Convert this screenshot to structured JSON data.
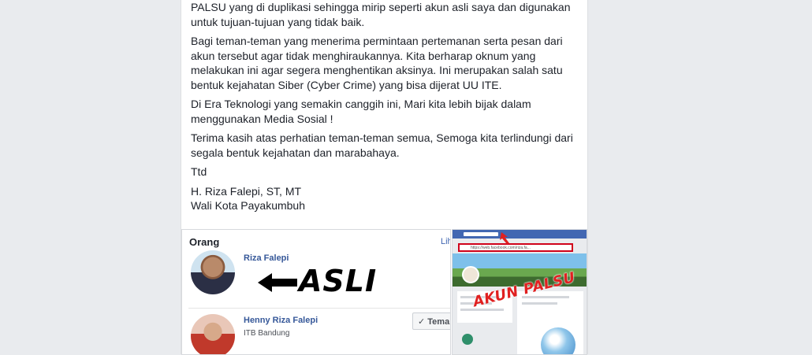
{
  "post": {
    "paragraphs": [
      "PALSU yang di duplikasi sehingga mirip seperti akun asli saya dan digunakan untuk tujuan-tujuan yang tidak baik.",
      "Bagi teman-teman yang menerima permintaan pertemanan serta pesan dari akun tersebut agar tidak menghiraukannya. Kita berharap oknum yang melakukan ini agar segera menghentikan aksinya. Ini merupakan salah satu bentuk kejahatan Siber (Cyber Crime) yang bisa dijerat UU ITE.",
      "Di Era Teknologi yang semakin canggih ini, Mari kita lebih bijak dalam menggunakan Media Sosial !",
      "Terima kasih atas perhatian teman-teman semua, Semoga kita terlindungi dari segala bentuk kejahatan dan marabahaya.",
      "Ttd"
    ],
    "signature_name": "H. Riza Falepi, ST, MT",
    "signature_title": "Wali Kota Payakumbuh"
  },
  "screenshot_left": {
    "section_title": "Orang",
    "see_all": "Liha",
    "person1_name": "Riza Falepi",
    "overlay_text": "ASLI",
    "person2_name": "Henny Riza Falepi",
    "person2_sub": "ITB Bandung",
    "friend_button": "✓ Teman"
  },
  "screenshot_right": {
    "overlay_text": "AKUN PALSU",
    "url_text": "https://web.facebook.com/riza.fa..."
  },
  "colors": {
    "page_bg": "#e9ebee",
    "link_blue": "#365899",
    "fb_blue": "#4267b2",
    "alert_red": "#e02020"
  }
}
